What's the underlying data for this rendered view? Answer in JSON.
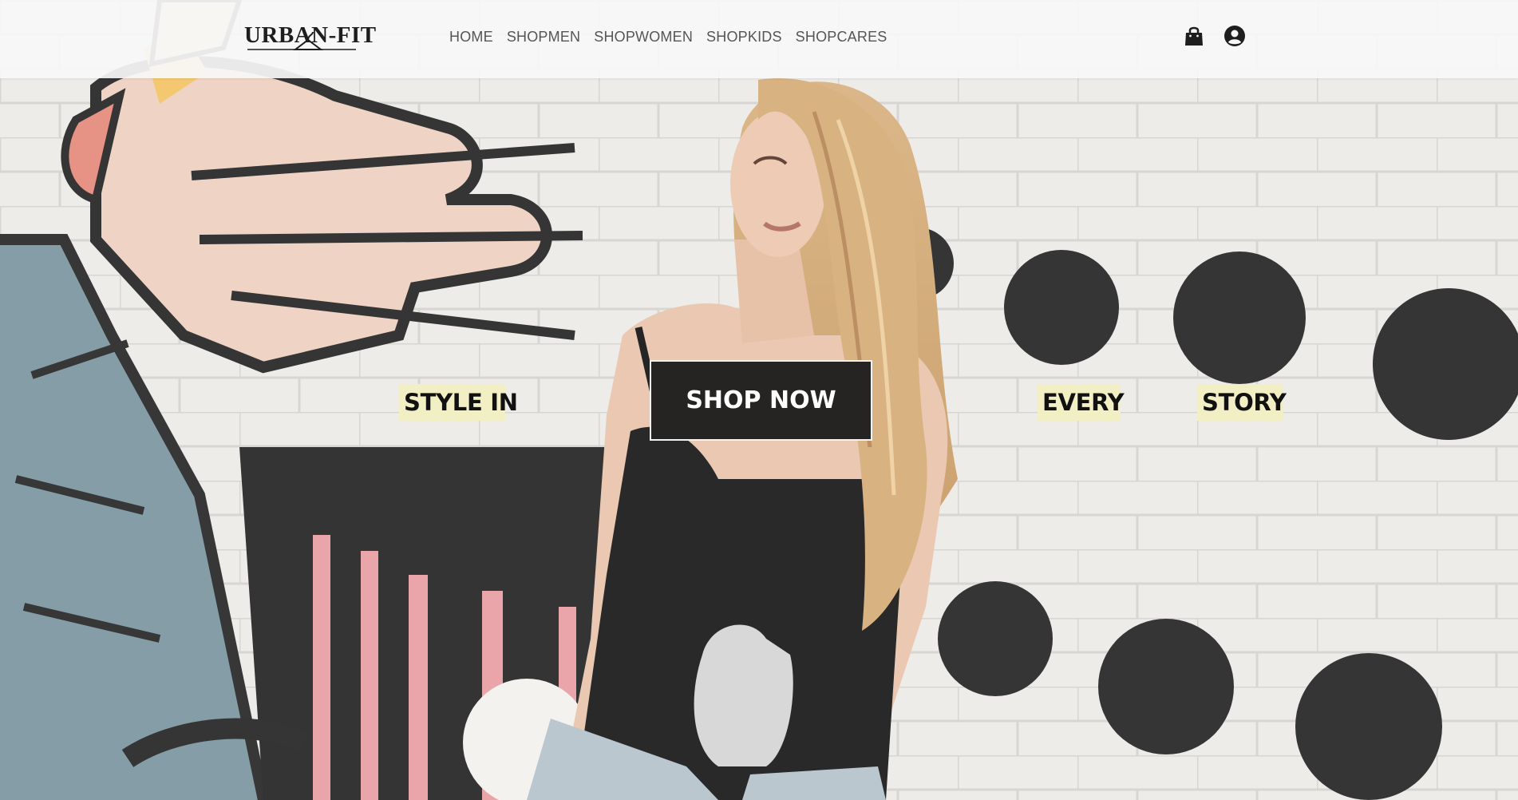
{
  "brand": {
    "logo_text": "URBAN-FIT"
  },
  "nav": {
    "items": [
      {
        "label": "HOME"
      },
      {
        "label": "SHOPMEN"
      },
      {
        "label": "SHOPWOMEN"
      },
      {
        "label": "SHOPKIDS"
      },
      {
        "label": "SHOPCARES"
      }
    ]
  },
  "header_icons": {
    "cart": "shopping-bag-icon",
    "account": "user-circle-icon"
  },
  "hero": {
    "tag_1": "STYLE IN",
    "tag_2": "EVERY",
    "tag_3": "STORY",
    "cta_label": "SHOP NOW"
  },
  "colors": {
    "header_bg": "#f8f8f8",
    "tag_bg": "#f1efc3",
    "cta_bg": "#252422",
    "cta_text": "#ffffff",
    "nav_text": "#555555"
  }
}
